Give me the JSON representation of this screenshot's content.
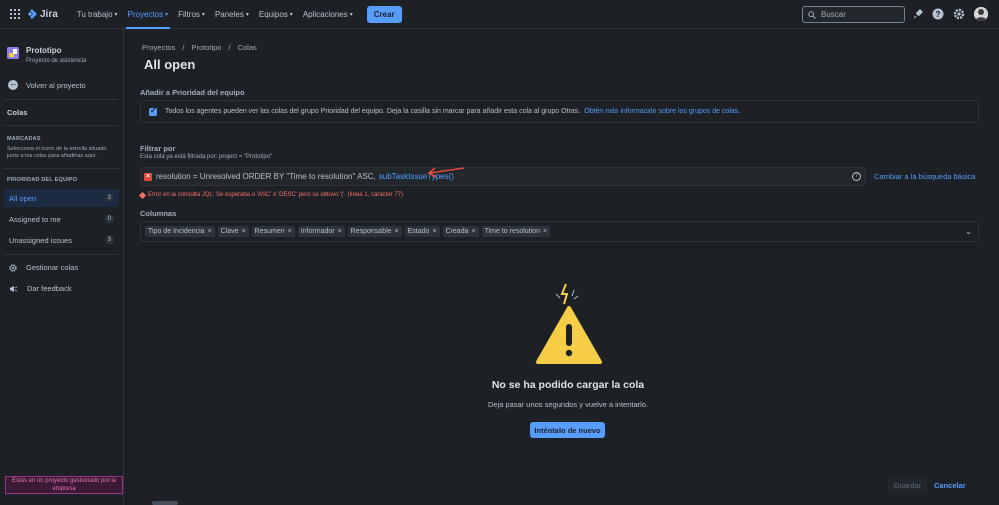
{
  "topbar": {
    "app_name": "Jira",
    "nav": [
      {
        "label": "Tu trabajo",
        "active": false
      },
      {
        "label": "Proyectos",
        "active": true
      },
      {
        "label": "Filtros",
        "active": false
      },
      {
        "label": "Paneles",
        "active": false
      },
      {
        "label": "Equipos",
        "active": false
      },
      {
        "label": "Aplicaciones",
        "active": false
      }
    ],
    "create_label": "Crear",
    "search_placeholder": "Buscar"
  },
  "sidebar": {
    "project_name": "Prototipo",
    "project_type": "Proyecto de asistencia",
    "back_label": "Volver al proyecto",
    "queues_heading": "Colas",
    "starred_heading": "MARCADAS",
    "starred_desc": "Selecciona el icono de la estrella situado junto a tus colas para añadirlas aquí.",
    "team_priority_heading": "PRIORIDAD DEL EQUIPO",
    "queues": [
      {
        "label": "All open",
        "count": "3",
        "active": true
      },
      {
        "label": "Assigned to me",
        "count": "0",
        "active": false
      },
      {
        "label": "Unassigned issues",
        "count": "3",
        "active": false
      }
    ],
    "manage_label": "Gestionar colas",
    "feedback_label": "Dar feedback",
    "managed_note": "Estás en un proyecto gestionado por la empresa"
  },
  "main": {
    "breadcrumb": [
      "Proyectos",
      "/",
      "Prototipo",
      "/",
      "Colas"
    ],
    "title": "All open",
    "add_priority_heading": "Añadir a Prioridad del equipo",
    "add_priority_text": "Todos los agentes pueden ver las colas del grupo Prioridad del equipo. Deja la casilla sin marcar para añadir esta cola al grupo Otras.",
    "add_priority_link": "Obtén más información sobre los grupos de colas.",
    "filter_heading": "Filtrar por",
    "filter_sub": "Esta cola ya está filtrada por:  project = \"Prototipo\"",
    "jql_text": "resolution = Unresolved ORDER BY \"Time to resolution\" ASC,",
    "jql_fn": "subTaskIssueTypes()",
    "switch_label": "Cambiar a la búsqueda básica",
    "error_text": "Error en la consulta JQL: Se esperaba o 'ASC' o 'DESC' pero se obtuvo '('. (línea 1, carácter 77)",
    "columns_heading": "Columnas",
    "columns": [
      "Tipo de Incidencia",
      "Clave",
      "Resumen",
      "Informador",
      "Responsable",
      "Estado",
      "Creada",
      "Time to resolution"
    ],
    "empty_title": "No se ha podido cargar la cola",
    "empty_desc": "Deja pasar unos segundos y vuelve a intentarlo.",
    "retry_label": "Inténtalo de nuevo",
    "save_label": "Guardar",
    "cancel_label": "Cancelar"
  },
  "colors": {
    "accent": "#579dff",
    "error": "#f87168",
    "warning": "#f5cd47",
    "background": "#1d2125"
  }
}
